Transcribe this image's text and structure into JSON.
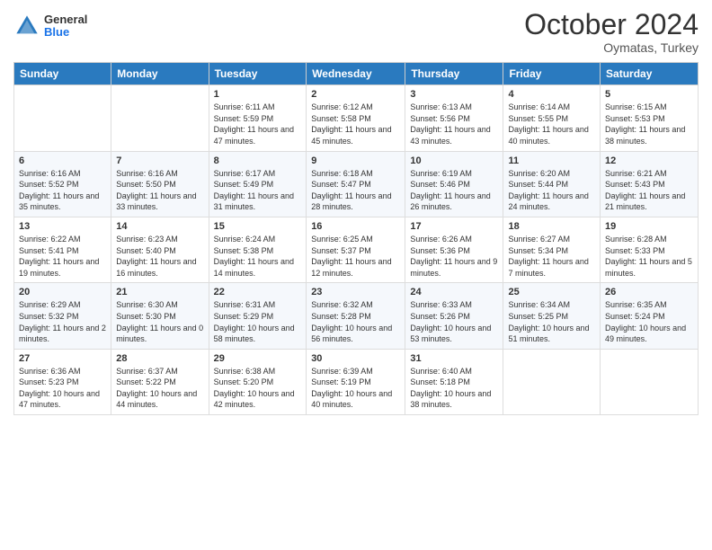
{
  "header": {
    "logo_general": "General",
    "logo_blue": "Blue",
    "month": "October 2024",
    "location": "Oymatas, Turkey"
  },
  "days_of_week": [
    "Sunday",
    "Monday",
    "Tuesday",
    "Wednesday",
    "Thursday",
    "Friday",
    "Saturday"
  ],
  "weeks": [
    [
      {
        "day": "",
        "sunrise": "",
        "sunset": "",
        "daylight": ""
      },
      {
        "day": "",
        "sunrise": "",
        "sunset": "",
        "daylight": ""
      },
      {
        "day": "1",
        "sunrise": "Sunrise: 6:11 AM",
        "sunset": "Sunset: 5:59 PM",
        "daylight": "Daylight: 11 hours and 47 minutes."
      },
      {
        "day": "2",
        "sunrise": "Sunrise: 6:12 AM",
        "sunset": "Sunset: 5:58 PM",
        "daylight": "Daylight: 11 hours and 45 minutes."
      },
      {
        "day": "3",
        "sunrise": "Sunrise: 6:13 AM",
        "sunset": "Sunset: 5:56 PM",
        "daylight": "Daylight: 11 hours and 43 minutes."
      },
      {
        "day": "4",
        "sunrise": "Sunrise: 6:14 AM",
        "sunset": "Sunset: 5:55 PM",
        "daylight": "Daylight: 11 hours and 40 minutes."
      },
      {
        "day": "5",
        "sunrise": "Sunrise: 6:15 AM",
        "sunset": "Sunset: 5:53 PM",
        "daylight": "Daylight: 11 hours and 38 minutes."
      }
    ],
    [
      {
        "day": "6",
        "sunrise": "Sunrise: 6:16 AM",
        "sunset": "Sunset: 5:52 PM",
        "daylight": "Daylight: 11 hours and 35 minutes."
      },
      {
        "day": "7",
        "sunrise": "Sunrise: 6:16 AM",
        "sunset": "Sunset: 5:50 PM",
        "daylight": "Daylight: 11 hours and 33 minutes."
      },
      {
        "day": "8",
        "sunrise": "Sunrise: 6:17 AM",
        "sunset": "Sunset: 5:49 PM",
        "daylight": "Daylight: 11 hours and 31 minutes."
      },
      {
        "day": "9",
        "sunrise": "Sunrise: 6:18 AM",
        "sunset": "Sunset: 5:47 PM",
        "daylight": "Daylight: 11 hours and 28 minutes."
      },
      {
        "day": "10",
        "sunrise": "Sunrise: 6:19 AM",
        "sunset": "Sunset: 5:46 PM",
        "daylight": "Daylight: 11 hours and 26 minutes."
      },
      {
        "day": "11",
        "sunrise": "Sunrise: 6:20 AM",
        "sunset": "Sunset: 5:44 PM",
        "daylight": "Daylight: 11 hours and 24 minutes."
      },
      {
        "day": "12",
        "sunrise": "Sunrise: 6:21 AM",
        "sunset": "Sunset: 5:43 PM",
        "daylight": "Daylight: 11 hours and 21 minutes."
      }
    ],
    [
      {
        "day": "13",
        "sunrise": "Sunrise: 6:22 AM",
        "sunset": "Sunset: 5:41 PM",
        "daylight": "Daylight: 11 hours and 19 minutes."
      },
      {
        "day": "14",
        "sunrise": "Sunrise: 6:23 AM",
        "sunset": "Sunset: 5:40 PM",
        "daylight": "Daylight: 11 hours and 16 minutes."
      },
      {
        "day": "15",
        "sunrise": "Sunrise: 6:24 AM",
        "sunset": "Sunset: 5:38 PM",
        "daylight": "Daylight: 11 hours and 14 minutes."
      },
      {
        "day": "16",
        "sunrise": "Sunrise: 6:25 AM",
        "sunset": "Sunset: 5:37 PM",
        "daylight": "Daylight: 11 hours and 12 minutes."
      },
      {
        "day": "17",
        "sunrise": "Sunrise: 6:26 AM",
        "sunset": "Sunset: 5:36 PM",
        "daylight": "Daylight: 11 hours and 9 minutes."
      },
      {
        "day": "18",
        "sunrise": "Sunrise: 6:27 AM",
        "sunset": "Sunset: 5:34 PM",
        "daylight": "Daylight: 11 hours and 7 minutes."
      },
      {
        "day": "19",
        "sunrise": "Sunrise: 6:28 AM",
        "sunset": "Sunset: 5:33 PM",
        "daylight": "Daylight: 11 hours and 5 minutes."
      }
    ],
    [
      {
        "day": "20",
        "sunrise": "Sunrise: 6:29 AM",
        "sunset": "Sunset: 5:32 PM",
        "daylight": "Daylight: 11 hours and 2 minutes."
      },
      {
        "day": "21",
        "sunrise": "Sunrise: 6:30 AM",
        "sunset": "Sunset: 5:30 PM",
        "daylight": "Daylight: 11 hours and 0 minutes."
      },
      {
        "day": "22",
        "sunrise": "Sunrise: 6:31 AM",
        "sunset": "Sunset: 5:29 PM",
        "daylight": "Daylight: 10 hours and 58 minutes."
      },
      {
        "day": "23",
        "sunrise": "Sunrise: 6:32 AM",
        "sunset": "Sunset: 5:28 PM",
        "daylight": "Daylight: 10 hours and 56 minutes."
      },
      {
        "day": "24",
        "sunrise": "Sunrise: 6:33 AM",
        "sunset": "Sunset: 5:26 PM",
        "daylight": "Daylight: 10 hours and 53 minutes."
      },
      {
        "day": "25",
        "sunrise": "Sunrise: 6:34 AM",
        "sunset": "Sunset: 5:25 PM",
        "daylight": "Daylight: 10 hours and 51 minutes."
      },
      {
        "day": "26",
        "sunrise": "Sunrise: 6:35 AM",
        "sunset": "Sunset: 5:24 PM",
        "daylight": "Daylight: 10 hours and 49 minutes."
      }
    ],
    [
      {
        "day": "27",
        "sunrise": "Sunrise: 6:36 AM",
        "sunset": "Sunset: 5:23 PM",
        "daylight": "Daylight: 10 hours and 47 minutes."
      },
      {
        "day": "28",
        "sunrise": "Sunrise: 6:37 AM",
        "sunset": "Sunset: 5:22 PM",
        "daylight": "Daylight: 10 hours and 44 minutes."
      },
      {
        "day": "29",
        "sunrise": "Sunrise: 6:38 AM",
        "sunset": "Sunset: 5:20 PM",
        "daylight": "Daylight: 10 hours and 42 minutes."
      },
      {
        "day": "30",
        "sunrise": "Sunrise: 6:39 AM",
        "sunset": "Sunset: 5:19 PM",
        "daylight": "Daylight: 10 hours and 40 minutes."
      },
      {
        "day": "31",
        "sunrise": "Sunrise: 6:40 AM",
        "sunset": "Sunset: 5:18 PM",
        "daylight": "Daylight: 10 hours and 38 minutes."
      },
      {
        "day": "",
        "sunrise": "",
        "sunset": "",
        "daylight": ""
      },
      {
        "day": "",
        "sunrise": "",
        "sunset": "",
        "daylight": ""
      }
    ]
  ]
}
